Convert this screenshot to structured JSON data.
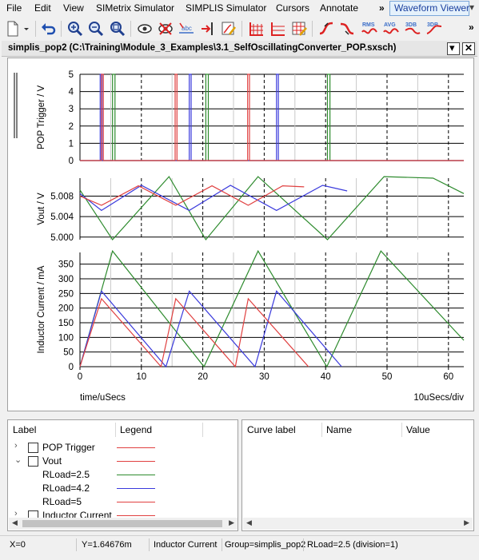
{
  "menu": {
    "items": [
      "File",
      "Edit",
      "View",
      "SIMetrix Simulator",
      "SIMPLIS Simulator",
      "Cursors",
      "Annotate"
    ],
    "overflow": "»",
    "active_label": "Waveform Viewer",
    "active_chevron": "▾",
    "right_overflow": "»"
  },
  "toolbar": {
    "icons": [
      "new-document-icon",
      "dropdown-arrow-icon",
      "undo-icon",
      "zoom-full-icon",
      "zoom-in-icon",
      "zoom-out-icon",
      "view-icon",
      "hide-icon",
      "abc-label-icon",
      "add-curve-icon",
      "edit-curve-icon",
      "grid-icon",
      "grid-axis-icon",
      "grid-edit-icon",
      "rising-edge-icon",
      "falling-edge-icon",
      "rms-icon",
      "avg-icon",
      "3db-icon",
      "3db-alt-icon"
    ],
    "rms_label": "RMS",
    "avg_label": "AVG",
    "db1_label": "3DB",
    "db2_label": "3DB",
    "overflow": "»"
  },
  "window": {
    "title": "simplis_pop2 (C:\\Training\\Module_3_Examples\\3.1_SelfOscillatingConverter_POP.sxsch)",
    "menu_button": "▾",
    "close_button": "✕"
  },
  "plot": {
    "x_axis_label": "time/uSecs",
    "x_scale_label": "10uSecs/div",
    "x_ticks": [
      "0",
      "10",
      "20",
      "30",
      "40",
      "50",
      "60"
    ]
  },
  "chart_data": [
    {
      "type": "line",
      "ylabel": "POP Trigger / V",
      "ylim": [
        0,
        5
      ],
      "yticks": [
        "0",
        "1",
        "2",
        "3",
        "4",
        "5"
      ],
      "xlim": [
        0,
        62.5
      ],
      "grid": true,
      "series": [
        {
          "name": "RLoad=2.5",
          "color": "#2e8b2e",
          "x": [
            0,
            5.3,
            5.3,
            5.7,
            5.7,
            20.5,
            20.5,
            20.9,
            20.9,
            40.3,
            40.3,
            40.7,
            40.7,
            62.5
          ],
          "y": [
            0,
            0,
            5,
            5,
            0,
            0,
            5,
            5,
            0,
            0,
            5,
            5,
            0,
            0
          ]
        },
        {
          "name": "RLoad=4.2",
          "color": "#3a3adc",
          "x": [
            0,
            3.3,
            3.3,
            3.6,
            3.6,
            17.8,
            17.8,
            18.1,
            18.1,
            32.0,
            32.0,
            32.3,
            32.3,
            62.5
          ],
          "y": [
            0,
            0,
            5,
            5,
            0,
            0,
            5,
            5,
            0,
            0,
            5,
            5,
            0,
            0
          ]
        },
        {
          "name": "RLoad=5",
          "color": "#e04040",
          "x": [
            0,
            3.5,
            3.5,
            3.8,
            3.8,
            15.5,
            15.5,
            15.8,
            15.8,
            27.3,
            27.3,
            27.6,
            27.6,
            62.5
          ],
          "y": [
            0,
            0,
            5,
            5,
            0,
            0,
            5,
            5,
            0,
            0,
            5,
            5,
            0,
            0
          ]
        }
      ]
    },
    {
      "type": "line",
      "ylabel": "Vout / V",
      "ylim": [
        4.9995,
        5.0115
      ],
      "yticks": [
        "5.000",
        "5.004",
        "5.008"
      ],
      "grid": true,
      "series": [
        {
          "name": "RLoad=2.5",
          "color": "#2e8b2e",
          "x": [
            0,
            5.3,
            14.5,
            20.5,
            29.0,
            40.3,
            49.5,
            57.5,
            62.5
          ],
          "y": [
            5.0092,
            4.9995,
            5.0118,
            4.9995,
            5.0118,
            4.9995,
            5.0118,
            5.0115,
            5.0085
          ]
        },
        {
          "name": "RLoad=4.2",
          "color": "#3a3adc",
          "x": [
            0,
            3.5,
            10.0,
            17.8,
            24.5,
            32.0,
            39.5,
            43.5
          ],
          "y": [
            5.0085,
            5.0052,
            5.0101,
            5.0052,
            5.0101,
            5.0052,
            5.0101,
            5.009
          ]
        },
        {
          "name": "RLoad=5",
          "color": "#e04040",
          "x": [
            0,
            3.5,
            9.5,
            15.6,
            21.5,
            27.4,
            33.0,
            36.5
          ],
          "y": [
            5.008,
            5.0062,
            5.01,
            5.0062,
            5.01,
            5.0062,
            5.01,
            5.0098
          ]
        }
      ]
    },
    {
      "type": "line",
      "ylabel": "Inductor Current / mA",
      "ylim": [
        0,
        390
      ],
      "yticks": [
        "0",
        "50",
        "100",
        "150",
        "200",
        "250",
        "300",
        "350"
      ],
      "grid": true,
      "series": [
        {
          "name": "RLoad=2.5",
          "color": "#2e8b2e",
          "x": [
            0,
            5.3,
            20.2,
            29.0,
            40.2,
            49.0,
            62.5
          ],
          "y": [
            0,
            395,
            0,
            395,
            0,
            395,
            90
          ]
        },
        {
          "name": "RLoad=4.2",
          "color": "#3a3adc",
          "x": [
            0,
            3.5,
            14.0,
            17.8,
            28.5,
            32.0,
            42.6
          ],
          "y": [
            0,
            258,
            0,
            258,
            0,
            258,
            0
          ]
        },
        {
          "name": "RLoad=5",
          "color": "#e04040",
          "x": [
            0,
            3.5,
            13.2,
            15.6,
            25.3,
            27.4,
            37.2
          ],
          "y": [
            0,
            232,
            0,
            232,
            0,
            232,
            0
          ]
        }
      ]
    }
  ],
  "legend_panel": {
    "header_label": "Label",
    "header_legend": "Legend",
    "rows": [
      {
        "label": "POP Trigger",
        "expander": "›",
        "color": "#e04040",
        "checkbox": true
      },
      {
        "label": "Vout",
        "expander": "⌄",
        "color": "#e04040",
        "checkbox": true
      },
      {
        "label": "RLoad=2.5",
        "expander": "",
        "color": "#2e8b2e",
        "checkbox": false
      },
      {
        "label": "RLoad=4.2",
        "expander": "",
        "color": "#3a3adc",
        "checkbox": false
      },
      {
        "label": "RLoad=5",
        "expander": "",
        "color": "#e04040",
        "checkbox": false
      },
      {
        "label": "Inductor Current",
        "expander": "›",
        "color": "#e04040",
        "checkbox": true
      }
    ]
  },
  "curve_panel": {
    "header_curve": "Curve label",
    "header_name": "Name",
    "header_value": "Value"
  },
  "status": {
    "x": "X=0",
    "y": "Y=1.64676m",
    "curve": "Inductor Current",
    "group": "Group=simplis_pop2",
    "rload": "RLoad=2.5 (division=1)"
  }
}
